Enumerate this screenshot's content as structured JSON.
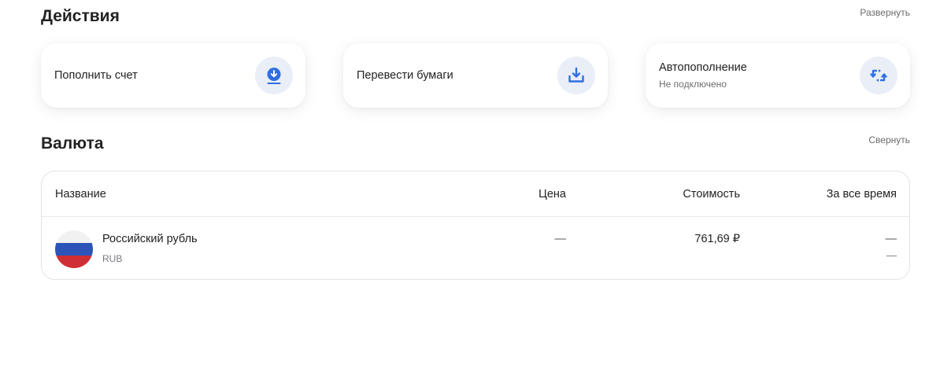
{
  "actions": {
    "title": "Действия",
    "toggle_label": "Развернуть",
    "cards": [
      {
        "title": "Пополнить счет",
        "subtitle": "",
        "icon": "download-circle-icon"
      },
      {
        "title": "Перевести бумаги",
        "subtitle": "",
        "icon": "tray-download-icon"
      },
      {
        "title": "Автопополнение",
        "subtitle": "Не подключено",
        "icon": "repeat-icon"
      }
    ]
  },
  "currency": {
    "title": "Валюта",
    "toggle_label": "Свернуть",
    "columns": {
      "name": "Название",
      "price": "Цена",
      "value": "Стоимость",
      "all_time": "За все время"
    },
    "rows": [
      {
        "name": "Российский рубль",
        "ticker": "RUB",
        "price": "—",
        "value": "761,69 ₽",
        "all_time_primary": "—",
        "all_time_secondary": "—",
        "flag": [
          "#f1f1f1",
          "#2c54b8",
          "#cf2f34"
        ]
      }
    ]
  },
  "colors": {
    "accent": "#2f6fe0",
    "icon_bg": "#e9eef7"
  }
}
